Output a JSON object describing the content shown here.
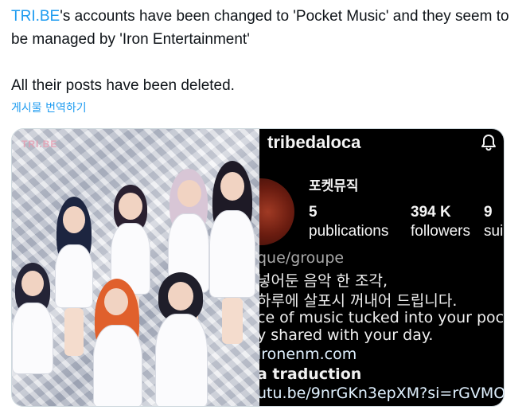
{
  "tweet": {
    "mention": "TRI.BE",
    "line1_rest": "'s accounts have been changed to 'Pocket Music' and they seem to be managed by 'Iron Entertainment'",
    "line2": "All their posts have been deleted.",
    "translate_label": "게시물 번역하기"
  },
  "media": {
    "photo_alt": "TRI.BE group photo",
    "logo_text": "TRI.BE",
    "instagram": {
      "username": "tribedaloca",
      "icon": "bell-icon",
      "display_name": "포켓뮤직",
      "stats": [
        {
          "value": "5",
          "label": "publications"
        },
        {
          "value": "394 K",
          "label": "followers"
        },
        {
          "value": "9",
          "label": "sui"
        }
      ],
      "bio": [
        "que/groupe",
        "넣어둔 음악 한 조각,",
        "하루에 살포시 꺼내어 드립니다.",
        "ce of music tucked into your pock",
        "y shared with your day.",
        "ironenm.com",
        "a traduction",
        "utu.be/9nrGKn3epXM?si=rGVMO"
      ]
    }
  }
}
